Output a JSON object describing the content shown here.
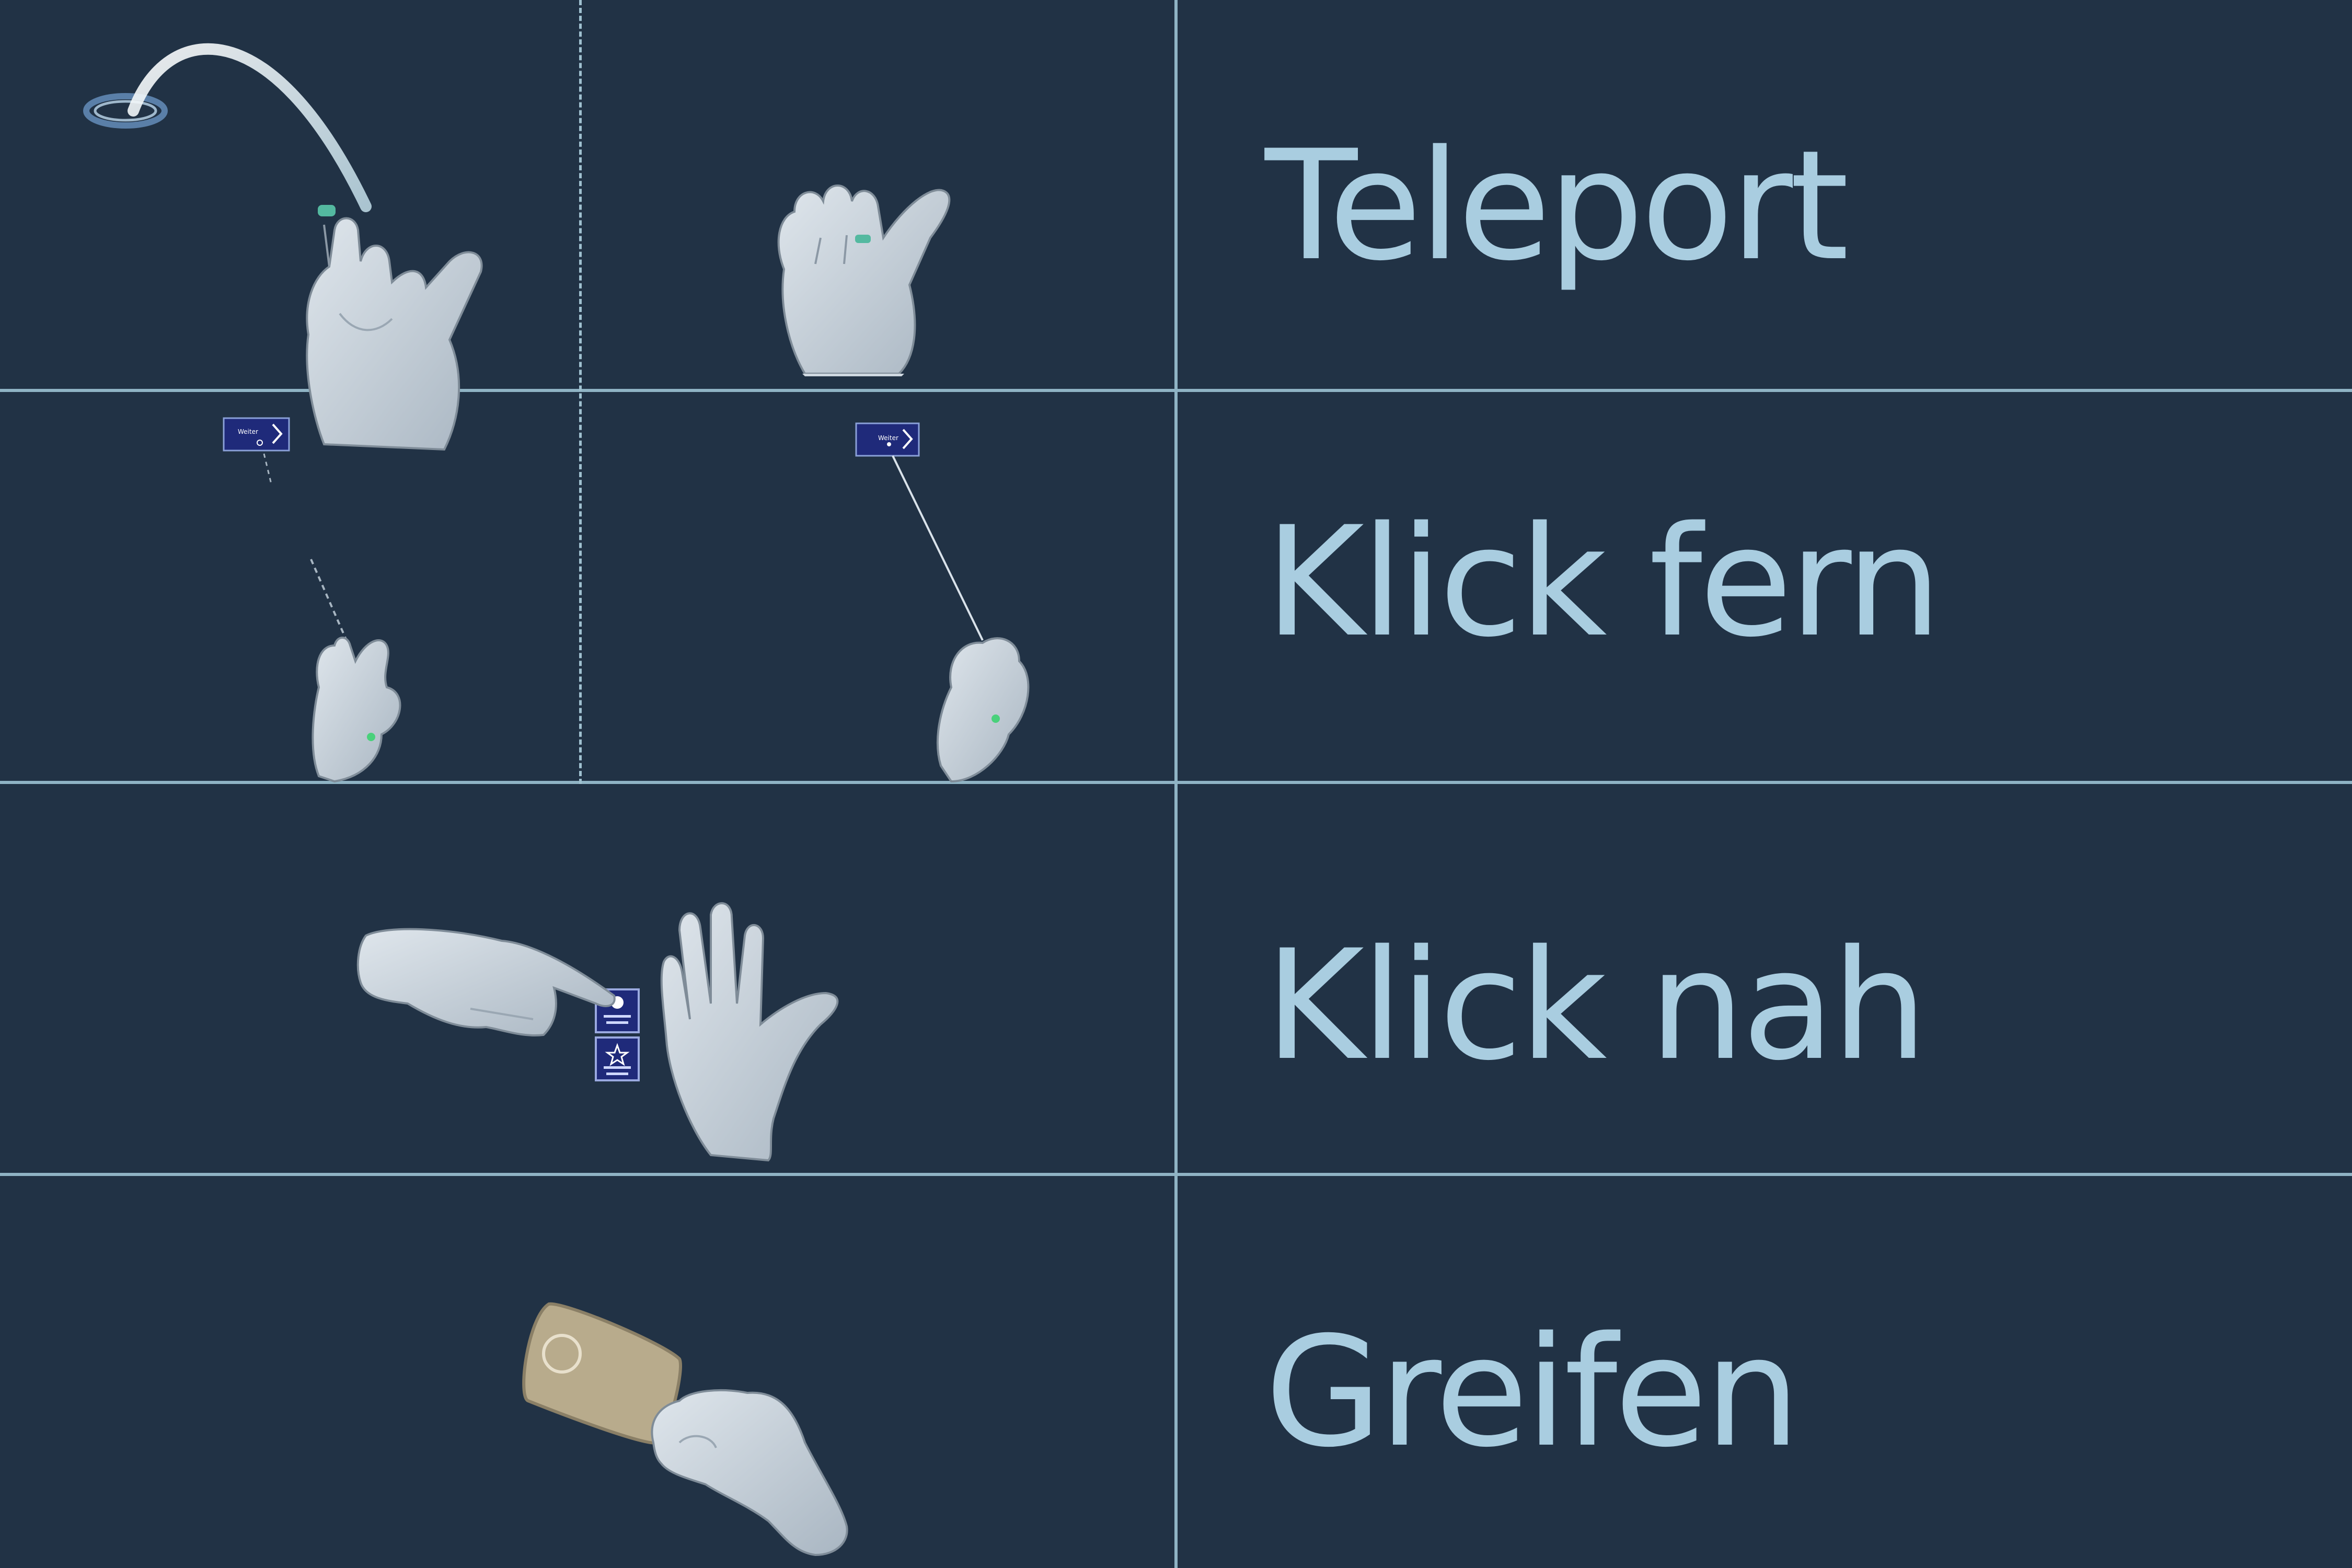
{
  "gestures": [
    {
      "label": "Teleport",
      "color": "#a9cde0"
    },
    {
      "label": "Klick fern",
      "color": "#a9cde0"
    },
    {
      "label": "Klick nah",
      "color": "#a9cde0"
    },
    {
      "label": "Greifen",
      "color": "#a9cde0"
    }
  ],
  "colors": {
    "background": "#213245",
    "grid_line": "#8fb3c4",
    "hand": "#c9d3dc",
    "ui_panel": "#1f2a7a",
    "card": "#b8ab8c"
  },
  "panel_icons": [
    "chevron-right-icon",
    "gear-icon",
    "star-icon"
  ]
}
